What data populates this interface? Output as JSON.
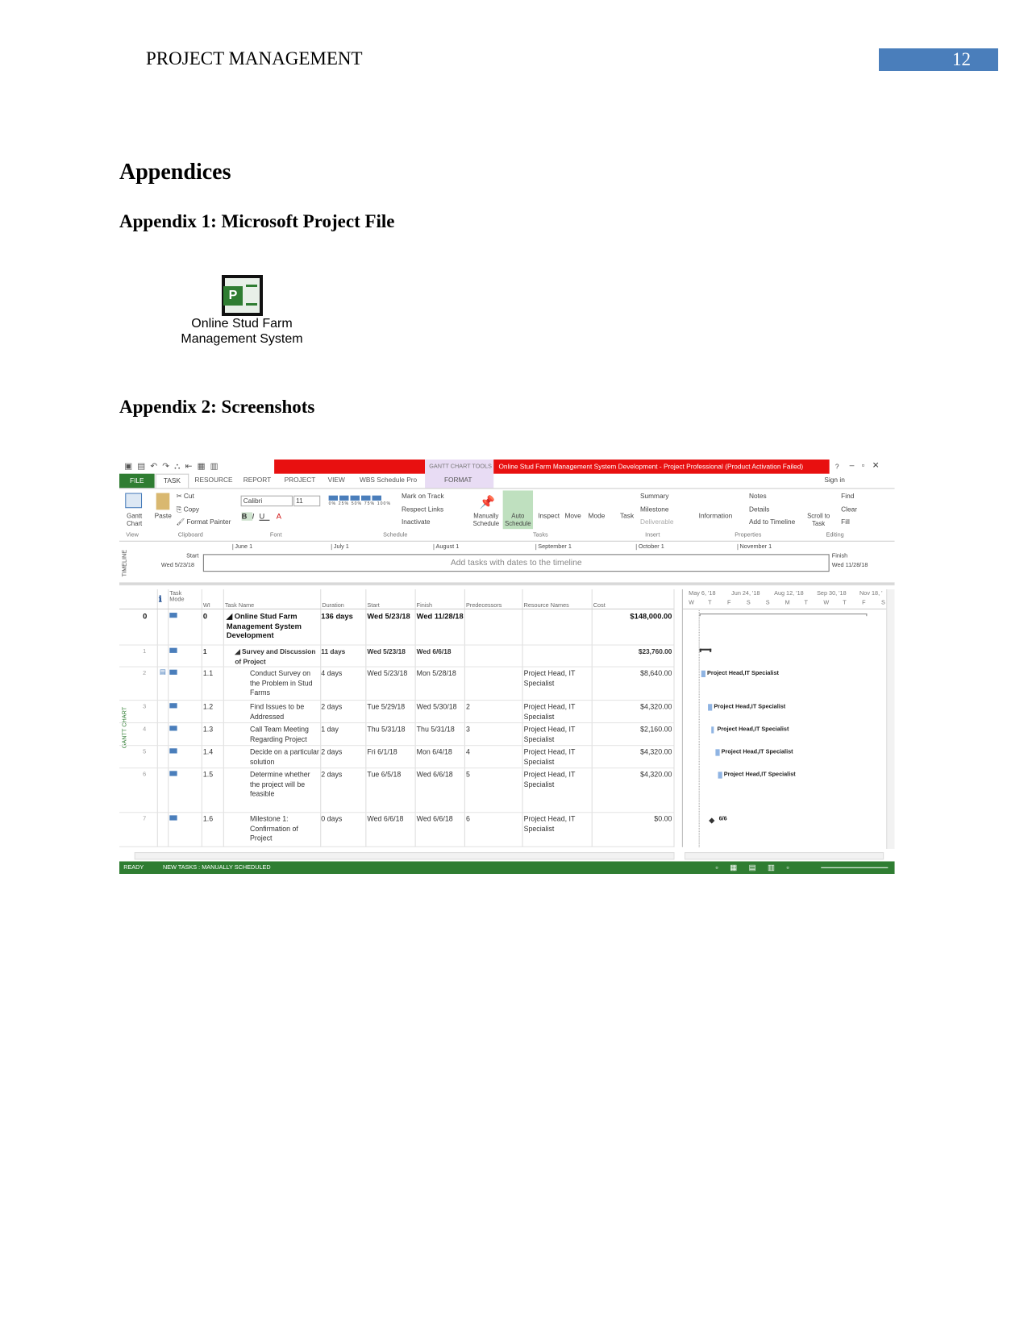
{
  "page": {
    "running_header": "PROJECT MANAGEMENT",
    "page_number": "12",
    "heading": "Appendices",
    "appendix1": "Appendix 1: Microsoft Project File",
    "file_label": "Online Stud Farm Management System",
    "file_icon": "ms-project-file-icon",
    "appendix2": "Appendix 2: Screenshots"
  },
  "app": {
    "title": "Online Stud Farm Management System Development -  Project Professional (Product Activation Failed)",
    "context_tab": "GANTT CHART TOOLS",
    "help": "?",
    "sign_in": "Sign in",
    "colors": {
      "title_bar": "#e81010",
      "file_tab": "#2f7d32",
      "context": "#e8dcf4",
      "status_bar": "#2f7d32"
    },
    "tabs": [
      "FILE",
      "TASK",
      "RESOURCE",
      "REPORT",
      "PROJECT",
      "VIEW",
      "WBS Schedule Pro",
      "FORMAT"
    ],
    "ribbon": {
      "gantt": "Gantt Chart",
      "paste": "Paste",
      "cut": "Cut",
      "copy": "Copy",
      "format_painter": "Format Painter",
      "font": "Calibri",
      "size": "11",
      "pct": [
        "0%",
        "25%",
        "50%",
        "75%",
        "100%"
      ],
      "mark_on_track": "Mark on Track",
      "respect_links": "Respect Links",
      "inactivate": "Inactivate",
      "manually": "Manually Schedule",
      "auto": "Auto Schedule",
      "inspect": "Inspect",
      "move": "Move",
      "mode": "Mode",
      "task": "Task",
      "summary": "Summary",
      "milestone": "Milestone",
      "deliverable": "Deliverable",
      "information": "Information",
      "notes": "Notes",
      "details": "Details",
      "add_timeline": "Add to Timeline",
      "scroll": "Scroll to Task",
      "find": "Find",
      "clear": "Clear",
      "fill": "Fill",
      "groups": [
        "View",
        "Clipboard",
        "Font",
        "Schedule",
        "Tasks",
        "Insert",
        "Properties",
        "Editing"
      ]
    },
    "timeline": {
      "label": "TIMELINE",
      "start_label": "Start",
      "start": "Wed 5/23/18",
      "finish_label": "Finish",
      "finish": "Wed 11/28/18",
      "months": [
        "June 1",
        "July 1",
        "August 1",
        "September 1",
        "October 1",
        "November 1"
      ],
      "placeholder": "Add tasks with dates to the timeline"
    },
    "side_label": "GANTT CHART",
    "columns": [
      "Task Mode",
      "WI",
      "Task Name",
      "Duration",
      "Start",
      "Finish",
      "Predecessors",
      "Resource Names",
      "Cost"
    ],
    "rows": [
      {
        "id": "0",
        "wbs": "0",
        "name": "◢ Online Stud Farm Management System Development",
        "dur": "136 days",
        "start": "Wed 5/23/18",
        "finish": "Wed 11/28/18",
        "pred": "",
        "res": "",
        "cost": "$148,000.00",
        "bold": true
      },
      {
        "id": "1",
        "wbs": "1",
        "name": "◢ Survey and Discussion of Project",
        "dur": "11 days",
        "start": "Wed 5/23/18",
        "finish": "Wed 6/6/18",
        "pred": "",
        "res": "",
        "cost": "$23,760.00",
        "semi": true
      },
      {
        "id": "2",
        "wbs": "1.1",
        "name": "Conduct Survey on the Problem in Stud Farms",
        "dur": "4 days",
        "start": "Wed 5/23/18",
        "finish": "Mon 5/28/18",
        "pred": "",
        "res": "Project Head, IT Specialist",
        "cost": "$8,640.00"
      },
      {
        "id": "3",
        "wbs": "1.2",
        "name": "Find Issues to be Addressed",
        "dur": "2 days",
        "start": "Tue 5/29/18",
        "finish": "Wed 5/30/18",
        "pred": "2",
        "res": "Project Head, IT Specialist",
        "cost": "$4,320.00"
      },
      {
        "id": "4",
        "wbs": "1.3",
        "name": "Call Team Meeting Regarding Project",
        "dur": "1 day",
        "start": "Thu 5/31/18",
        "finish": "Thu 5/31/18",
        "pred": "3",
        "res": "Project Head, IT Specialist",
        "cost": "$2,160.00"
      },
      {
        "id": "5",
        "wbs": "1.4",
        "name": "Decide on a particular solution",
        "dur": "2 days",
        "start": "Fri 6/1/18",
        "finish": "Mon 6/4/18",
        "pred": "4",
        "res": "Project Head, IT Specialist",
        "cost": "$4,320.00"
      },
      {
        "id": "6",
        "wbs": "1.5",
        "name": "Determine whether the project will be feasible",
        "dur": "2 days",
        "start": "Tue 6/5/18",
        "finish": "Wed 6/6/18",
        "pred": "5",
        "res": "Project Head, IT Specialist",
        "cost": "$4,320.00"
      },
      {
        "id": "7",
        "wbs": "1.6",
        "name": "Milestone 1: Confirmation of Project",
        "dur": "0 days",
        "start": "Wed 6/6/18",
        "finish": "Wed 6/6/18",
        "pred": "6",
        "res": "Project Head, IT Specialist",
        "cost": "$0.00"
      }
    ],
    "gantt": {
      "periods": [
        "May 6, '18",
        "Jun 24, '18",
        "Aug 12, '18",
        "Sep 30, '18",
        "Nov 18, '"
      ],
      "days": [
        "W",
        "T",
        "F",
        "S",
        "S",
        "M",
        "T",
        "W",
        "T",
        "F",
        "S"
      ],
      "bar_label": "Project Head,IT Specialist",
      "milestone_label": "6/6"
    },
    "status": {
      "ready": "READY",
      "new_tasks": "NEW TASKS : MANUALLY SCHEDULED"
    }
  }
}
